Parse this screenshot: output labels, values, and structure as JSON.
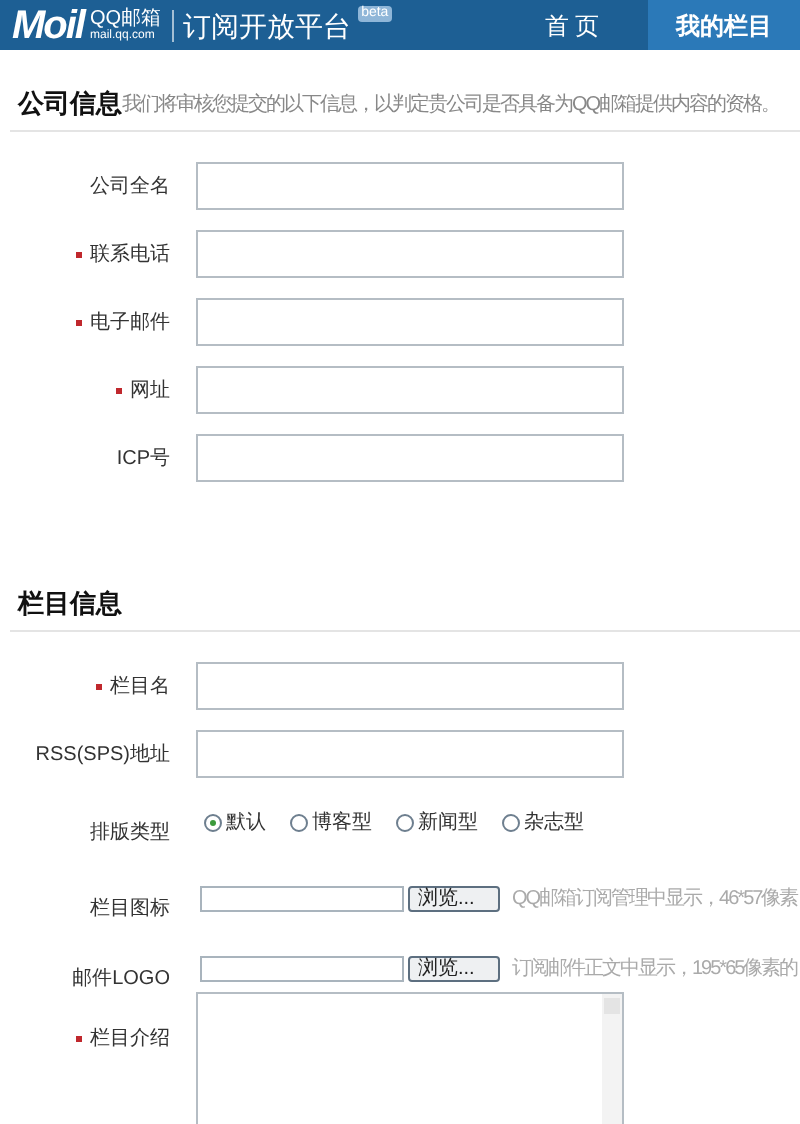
{
  "header": {
    "logo": "Moil",
    "brand": "QQ邮箱",
    "domain": "mail.qq.com",
    "title": "订阅开放平台",
    "badge": "beta",
    "tabs": [
      {
        "label": "首 页",
        "selected": false
      },
      {
        "label": "我的栏目",
        "selected": true
      }
    ]
  },
  "sections": [
    {
      "title": "公司信息",
      "note": "我们将审核您提交的以下信息，以判定贵公司是否具备为QQ邮箱提供内容的资格。",
      "fields": [
        {
          "kind": "text",
          "label": "公司全名",
          "required": false
        },
        {
          "kind": "text",
          "label": "联系电话",
          "required": true
        },
        {
          "kind": "text",
          "label": "电子邮件",
          "required": true
        },
        {
          "kind": "text",
          "label": "网址",
          "required": true
        },
        {
          "kind": "text",
          "label": "ICP号",
          "required": false
        }
      ]
    },
    {
      "title": "栏目信息",
      "fields": [
        {
          "kind": "text",
          "label": "栏目名",
          "required": true
        },
        {
          "kind": "text",
          "label": "RSS(SPS)地址",
          "required": false
        },
        {
          "kind": "radio",
          "label": "排版类型",
          "required": false,
          "options": [
            {
              "label": "默认",
              "selected": true
            },
            {
              "label": "博客型",
              "selected": false
            },
            {
              "label": "新闻型",
              "selected": false
            },
            {
              "label": "杂志型",
              "selected": false
            }
          ]
        },
        {
          "kind": "file",
          "label": "栏目图标",
          "required": false,
          "button": "浏览...",
          "hint": "QQ邮箱订阅管理中显示，46*57像素"
        },
        {
          "kind": "file",
          "label": "邮件LOGO",
          "required": false,
          "button": "浏览...",
          "hint": "订阅邮件正文中显示，195*65像素的"
        },
        {
          "kind": "textarea",
          "label": "栏目介绍",
          "required": true
        }
      ]
    }
  ]
}
